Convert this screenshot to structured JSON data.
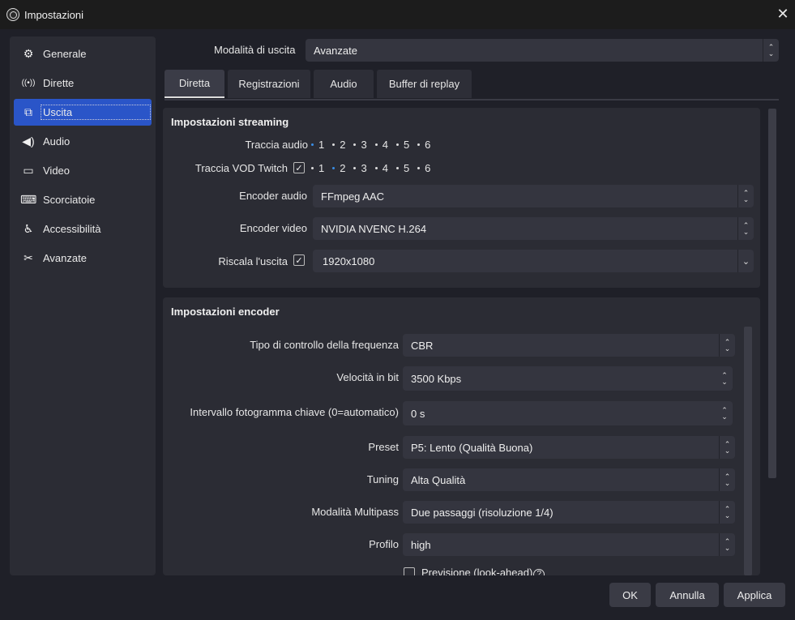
{
  "window": {
    "title": "Impostazioni"
  },
  "sidebar": {
    "items": [
      {
        "label": "Generale",
        "icon": "gear-icon",
        "glyph": "⚙"
      },
      {
        "label": "Dirette",
        "icon": "antenna-icon",
        "glyph": "((•))"
      },
      {
        "label": "Uscita",
        "icon": "output-icon",
        "glyph": "⧉"
      },
      {
        "label": "Audio",
        "icon": "speaker-icon",
        "glyph": "🔈"
      },
      {
        "label": "Video",
        "icon": "monitor-icon",
        "glyph": "▭"
      },
      {
        "label": "Scorciatoie",
        "icon": "keyboard-icon",
        "glyph": "⌨"
      },
      {
        "label": "Accessibilità",
        "icon": "accessibility-icon",
        "glyph": "♿"
      },
      {
        "label": "Avanzate",
        "icon": "tools-icon",
        "glyph": "✂"
      }
    ],
    "active_index": 2
  },
  "output_mode": {
    "label": "Modalità di uscita",
    "value": "Avanzate"
  },
  "tabs": [
    "Diretta",
    "Registrazioni",
    "Audio",
    "Buffer di replay"
  ],
  "streaming": {
    "title": "Impostazioni streaming",
    "audio_track_label": "Traccia audio",
    "vod_track_label": "Traccia VOD Twitch",
    "tracks": [
      "1",
      "2",
      "3",
      "4",
      "5",
      "6"
    ],
    "audio_encoder_label": "Encoder audio",
    "audio_encoder_value": "FFmpeg AAC",
    "video_encoder_label": "Encoder video",
    "video_encoder_value": "NVIDIA NVENC H.264",
    "rescale_label": "Riscala l'uscita",
    "rescale_value": "1920x1080",
    "check_mark": "✓"
  },
  "encoder": {
    "title": "Impostazioni encoder",
    "rate_control_label": "Tipo di controllo della frequenza",
    "rate_control_value": "CBR",
    "bitrate_label": "Velocità in bit",
    "bitrate_value": "3500 Kbps",
    "keyframe_label": "Intervallo fotogramma chiave (0=automatico)",
    "keyframe_value": "0 s",
    "preset_label": "Preset",
    "preset_value": "P5: Lento (Qualità Buona)",
    "tuning_label": "Tuning",
    "tuning_value": "Alta Qualità",
    "multipass_label": "Modalità Multipass",
    "multipass_value": "Due passaggi (risoluzione 1/4)",
    "profile_label": "Profilo",
    "profile_value": "high",
    "lookahead_label": "Previsione (look-ahead)",
    "help_glyph": "?"
  },
  "buttons": {
    "ok": "OK",
    "cancel": "Annulla",
    "apply": "Applica"
  },
  "colors": {
    "accent": "#2a55c8",
    "track_selected": "#3a8ee6"
  }
}
